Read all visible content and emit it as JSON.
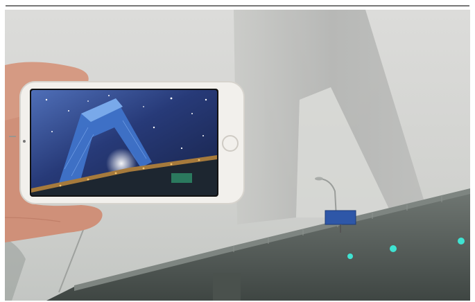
{
  "figure": {
    "alt_text": "",
    "road_sign_text": "",
    "colors": {
      "fog": "#d3d4d1",
      "tower": "#b7b8b6",
      "bridge": "#5a615d",
      "phone_body": "#f2f0ec",
      "screen_sky": "#2b3a73",
      "skin": "#d59a83",
      "signal_light": "#3fe3d2",
      "sign_blue": "#2e57a8"
    }
  }
}
